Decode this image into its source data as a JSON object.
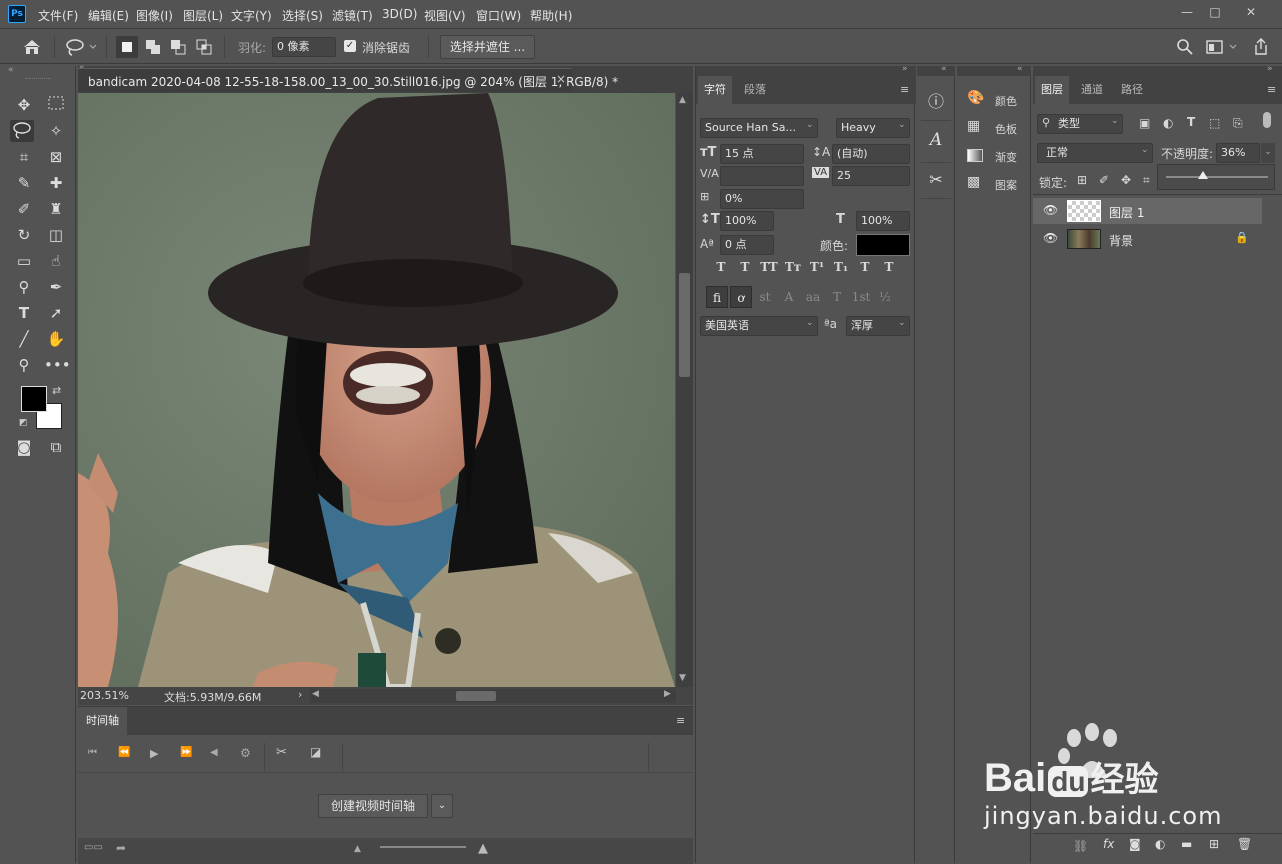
{
  "app": {
    "logo": "Ps"
  },
  "menu": [
    "文件(F)",
    "编辑(E)",
    "图像(I)",
    "图层(L)",
    "文字(Y)",
    "选择(S)",
    "滤镜(T)",
    "3D(D)",
    "视图(V)",
    "窗口(W)",
    "帮助(H)"
  ],
  "window_controls": [
    "—",
    "□",
    "✕"
  ],
  "options": {
    "feather_label": "羽化:",
    "feather_value": "0 像素",
    "antialias_label": "消除锯齿",
    "select_mask_button": "选择并遮住 ..."
  },
  "document": {
    "tab_title": "bandicam 2020-04-08 12-55-18-158.00_13_00_30.Still016.jpg @ 204% (图层 1, RGB/8) *",
    "close": "×",
    "zoom": "203.51%",
    "doc_info": "文档:5.93M/9.66M",
    "status_arrow": "›"
  },
  "timeline": {
    "tab": "时间轴",
    "create_button": "创建视频时间轴"
  },
  "character": {
    "tabs": [
      "字符",
      "段落"
    ],
    "font_family": "Source Han Sa...",
    "font_style": "Heavy",
    "font_size": "15 点",
    "leading": "(自动)",
    "kerning": "",
    "tracking": "25",
    "scale_percent": "0%",
    "vertical_scale": "100%",
    "horizontal_scale": "100%",
    "baseline_shift": "0 点",
    "color_label": "颜色:",
    "style_buttons": [
      "T",
      "T",
      "TT",
      "Tт",
      "T¹",
      "T₁",
      "T",
      "T"
    ],
    "opentype_buttons": [
      "fi",
      "ơ",
      "st",
      "A",
      "aa",
      "T",
      "1st",
      "½"
    ],
    "language": "美国英语",
    "antialias_icon": "ªa",
    "antialias": "浑厚",
    "colors": {
      "text_color": "#000000"
    }
  },
  "mid_icons": [
    "ⓘ",
    "A",
    "✂"
  ],
  "swatches_panel": {
    "items": [
      {
        "icon": "palette-icon",
        "label": "颜色"
      },
      {
        "icon": "grid-icon",
        "label": "色板"
      },
      {
        "icon": "gradient-icon",
        "label": "渐变"
      },
      {
        "icon": "pattern-icon",
        "label": "图案"
      }
    ]
  },
  "layers": {
    "tabs": [
      "图层",
      "通道",
      "路径"
    ],
    "filter_kind": "类型",
    "blend_mode": "正常",
    "opacity_label": "不透明度:",
    "opacity_value": "36%",
    "opacity_fraction": 0.36,
    "lock_label": "锁定:",
    "items": [
      {
        "name": "图层 1",
        "selected": true,
        "visible": true
      },
      {
        "name": "背景",
        "selected": false,
        "visible": true,
        "locked": true
      }
    ]
  },
  "watermark": {
    "brand": "Bai",
    "brand2": "du",
    "text": "经验",
    "url": "jingyan.baidu.com"
  }
}
